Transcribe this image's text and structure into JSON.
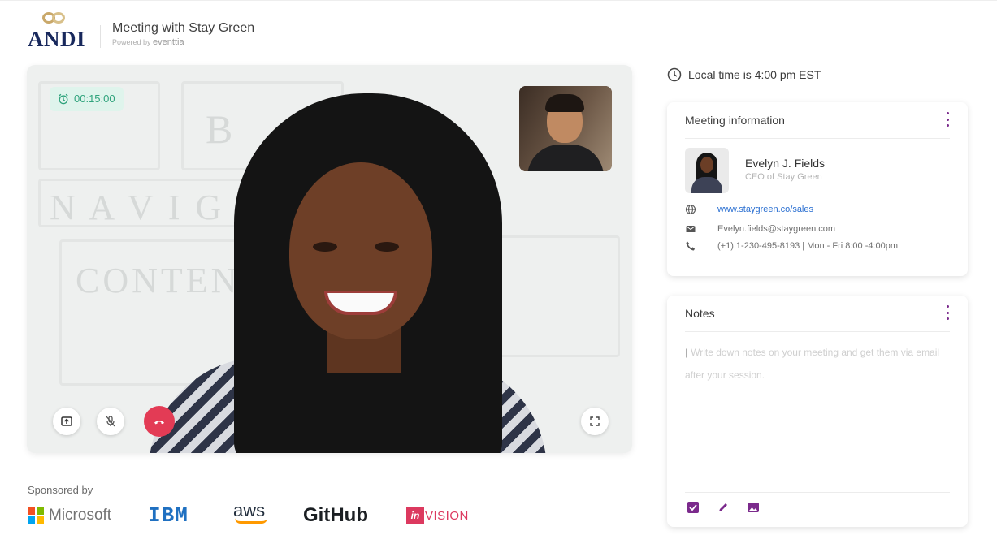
{
  "header": {
    "logo_text": "ANDI",
    "title": "Meeting with Stay Green",
    "powered_prefix": "Powered by",
    "powered_brand": "eventtia"
  },
  "video": {
    "timer": "00:15:00",
    "accent": "#2fa37c",
    "controls": [
      "share-screen-icon",
      "mute-microphone-icon",
      "end-call-icon",
      "fullscreen-icon"
    ]
  },
  "sponsors": {
    "label": "Sponsored by",
    "items": [
      "Microsoft",
      "IBM",
      "aws",
      "GitHub",
      "invision"
    ],
    "invision_badge": "in",
    "invision_rest": "VISION"
  },
  "sidebar": {
    "local_time": "Local time is 4:00 pm EST",
    "meeting_info": {
      "title": "Meeting information",
      "contact_name": "Evelyn J. Fields",
      "contact_role": "CEO of Stay Green",
      "website": "www.staygreen.co/sales",
      "email": "Evelyn.fields@staygreen.com",
      "phone": "(+1) 1-230-495-8193 | Mon - Fri 8:00 -4:00pm"
    },
    "notes": {
      "title": "Notes",
      "placeholder": "Write down notes on your meeting and get them via email after your session.",
      "tools": [
        "checkbox-icon",
        "pen-icon",
        "image-icon"
      ]
    }
  },
  "colors": {
    "brand_navy": "#18285c",
    "accent_purple": "#7b2a8c",
    "end_call_red": "#e33b55",
    "link_blue": "#2a6fd1"
  }
}
